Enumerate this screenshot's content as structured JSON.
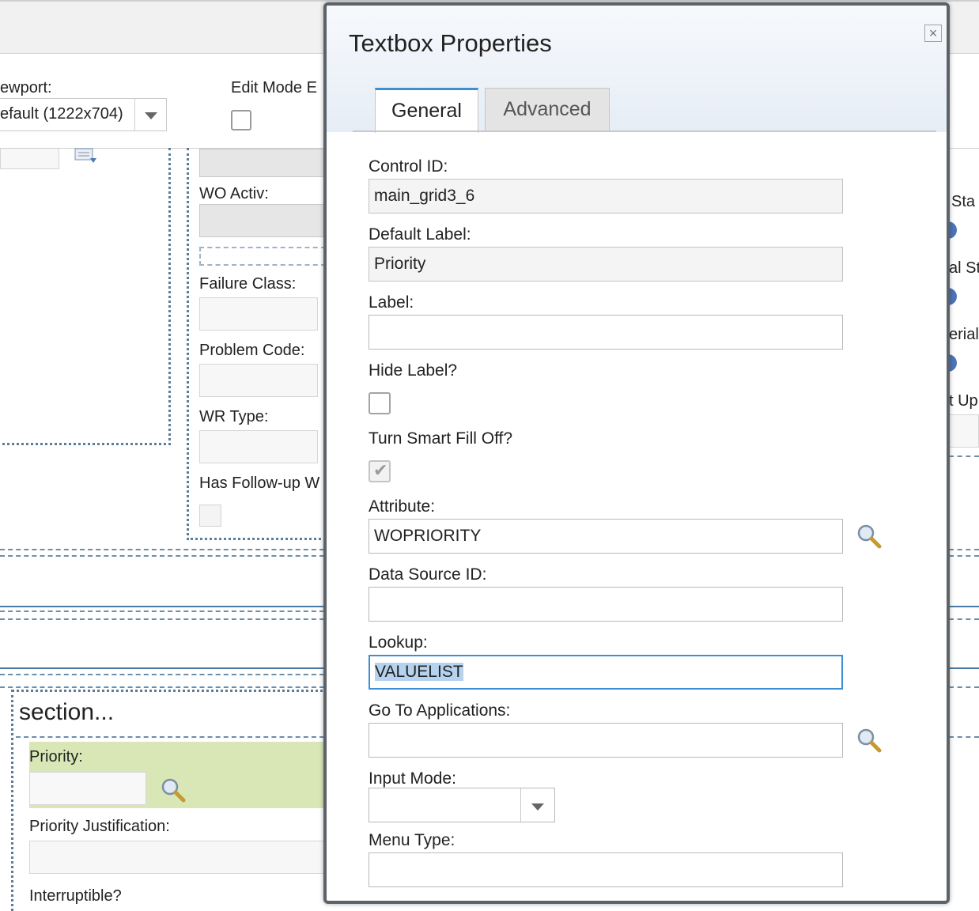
{
  "background": {
    "viewport_label": "ewport:",
    "viewport_value": "efault (1222x704)",
    "edit_mode_label": "Edit Mode E",
    "wo_activ_label": "WO Activ:",
    "failure_class_label": "Failure Class:",
    "problem_code_label": "Problem Code:",
    "wr_type_label": "WR Type:",
    "has_followup_label": "Has Follow-up W",
    "section_title": "section...",
    "priority_label": "Priority:",
    "priority_justification_label": "Priority Justification:",
    "interruptible_label": "Interruptible?",
    "right_labels": [
      "Sta",
      "al St",
      "erial",
      "t Up"
    ]
  },
  "dialog": {
    "title": "Textbox Properties",
    "close": "×",
    "tabs": [
      {
        "label": "General",
        "active": true
      },
      {
        "label": "Advanced",
        "active": false
      }
    ],
    "fields": {
      "control_id": {
        "label": "Control ID:",
        "value": "main_grid3_6"
      },
      "default_label": {
        "label": "Default Label:",
        "value": "Priority"
      },
      "label": {
        "label": "Label:",
        "value": ""
      },
      "hide_label": {
        "label": "Hide Label?",
        "checked": false
      },
      "smart_fill": {
        "label": "Turn Smart Fill Off?",
        "checked": true
      },
      "attribute": {
        "label": "Attribute:",
        "value": "WOPRIORITY"
      },
      "data_source_id": {
        "label": "Data Source ID:",
        "value": ""
      },
      "lookup": {
        "label": "Lookup:",
        "value": "VALUELIST"
      },
      "go_to_applications": {
        "label": "Go To Applications:",
        "value": ""
      },
      "input_mode": {
        "label": "Input Mode:",
        "value": ""
      },
      "menu_type": {
        "label": "Menu Type:",
        "value": ""
      }
    }
  },
  "colors": {
    "accent": "#3b8fd4",
    "section_highlight": "#d9e6b6",
    "dashed_border": "#5b7d99"
  }
}
